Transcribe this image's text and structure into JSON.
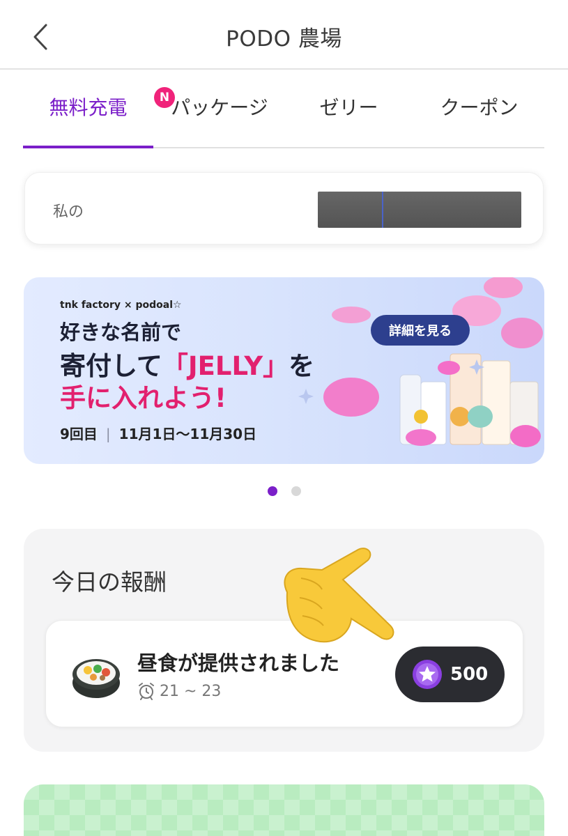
{
  "header": {
    "title": "PODO 農場",
    "back_icon": "chevron-left-icon"
  },
  "tabs": {
    "items": [
      {
        "label": "無料充電",
        "active": true,
        "badge": "N"
      },
      {
        "label": "パッケージ",
        "active": false
      },
      {
        "label": "ゼリー",
        "active": false
      },
      {
        "label": "クーポン",
        "active": false
      }
    ],
    "active_color": "#7b1fc9",
    "badge_color": "#f0237a"
  },
  "my_section": {
    "label": "私の"
  },
  "banner": {
    "brand": "tnk factory × podoal☆",
    "line1": "好きな名前で",
    "line2_a": "寄付して",
    "line2_b": "「JELLY」",
    "line2_c": "を",
    "line3": "手に入れよう!",
    "round": "9回目",
    "period": "11月1日〜11月30日",
    "button_label": "詳細を見る",
    "pages": 2,
    "current_page": 1
  },
  "reward": {
    "title": "今日の報酬",
    "item": {
      "icon": "kimbap-icon",
      "title": "昼食が提供されました",
      "time_icon": "alarm-clock-icon",
      "time": "21 ~ 23",
      "coin_icon": "star-coin-icon",
      "amount": "500"
    }
  }
}
